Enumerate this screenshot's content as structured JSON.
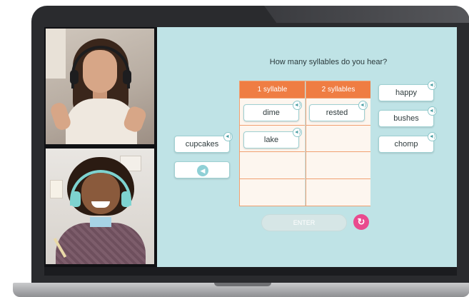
{
  "game": {
    "question": "How many syllables do you hear?",
    "columns": [
      {
        "label": "1 syllable"
      },
      {
        "label": "2 syllables"
      }
    ],
    "placed_words": {
      "col1_row1": "dime",
      "col1_row2": "lake",
      "col2_row1": "rested"
    },
    "left_words": {
      "cupcakes": "cupcakes"
    },
    "right_words": [
      "happy",
      "bushes",
      "chomp"
    ],
    "enter_label": "ENTER",
    "audio_glyph": "◄)",
    "speaker_glyph": "🔊",
    "reset_glyph": "↻"
  },
  "colors": {
    "game_background": "#bfe3e6",
    "header_orange": "#ef7d43",
    "reset_pink": "#e94a8e"
  },
  "icons": {
    "speaker": "speaker-icon",
    "reset": "reset-icon",
    "audio_badge": "audio-icon"
  }
}
